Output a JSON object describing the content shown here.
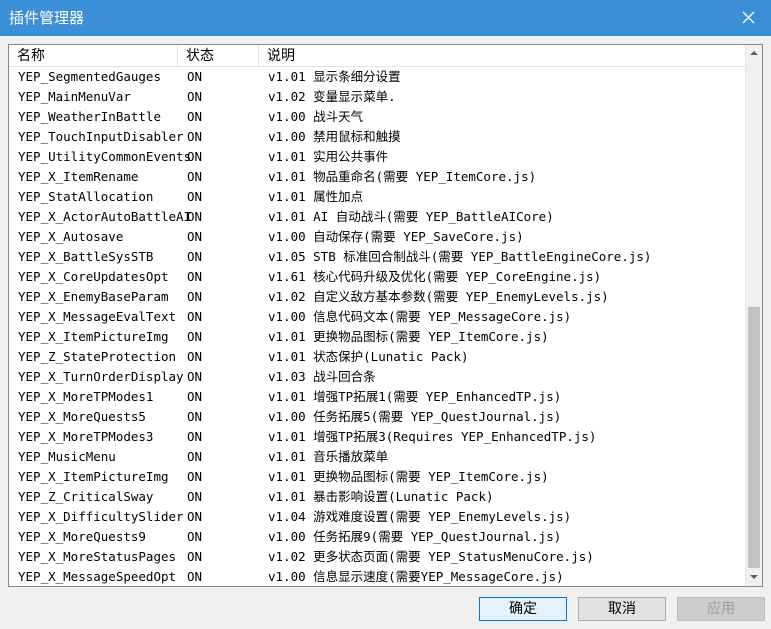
{
  "window": {
    "title": "插件管理器"
  },
  "columns": {
    "name": "名称",
    "status": "状态",
    "description": "说明"
  },
  "plugins": [
    {
      "name": "YEP_SegmentedGauges",
      "status": "ON",
      "description": "v1.01 显示条细分设置"
    },
    {
      "name": "YEP_MainMenuVar",
      "status": "ON",
      "description": "v1.02 变量显示菜单."
    },
    {
      "name": "YEP_WeatherInBattle",
      "status": "ON",
      "description": "v1.00 战斗天气"
    },
    {
      "name": "YEP_TouchInputDisabler",
      "status": "ON",
      "description": "v1.00 禁用鼠标和触摸"
    },
    {
      "name": "YEP_UtilityCommonEvents",
      "status": "ON",
      "description": "v1.01 实用公共事件"
    },
    {
      "name": "YEP_X_ItemRename",
      "status": "ON",
      "description": "v1.01 物品重命名(需要 YEP_ItemCore.js)"
    },
    {
      "name": "YEP_StatAllocation",
      "status": "ON",
      "description": "v1.01 属性加点"
    },
    {
      "name": "YEP_X_ActorAutoBattleAI",
      "status": "ON",
      "description": "v1.01 AI 自动战斗(需要 YEP_BattleAICore)"
    },
    {
      "name": "YEP_X_Autosave",
      "status": "ON",
      "description": "v1.00 自动保存(需要 YEP_SaveCore.js)"
    },
    {
      "name": "YEP_X_BattleSysSTB",
      "status": "ON",
      "description": "v1.05 STB 标准回合制战斗(需要 YEP_BattleEngineCore.js)"
    },
    {
      "name": "YEP_X_CoreUpdatesOpt",
      "status": "ON",
      "description": "v1.61 核心代码升级及优化(需要 YEP_CoreEngine.js)"
    },
    {
      "name": "YEP_X_EnemyBaseParam",
      "status": "ON",
      "description": "v1.02 自定义敌方基本参数(需要 YEP_EnemyLevels.js)"
    },
    {
      "name": "YEP_X_MessageEvalText",
      "status": "ON",
      "description": "v1.00 信息代码文本(需要 YEP_MessageCore.js)"
    },
    {
      "name": "YEP_X_ItemPictureImg",
      "status": "ON",
      "description": "v1.01 更换物品图标(需要 YEP_ItemCore.js)"
    },
    {
      "name": "YEP_Z_StateProtection",
      "status": "ON",
      "description": "v1.01 状态保护(Lunatic Pack)"
    },
    {
      "name": "YEP_X_TurnOrderDisplay",
      "status": "ON",
      "description": "v1.03 战斗回合条"
    },
    {
      "name": "YEP_X_MoreTPModes1",
      "status": "ON",
      "description": "v1.01 增强TP拓展1(需要 YEP_EnhancedTP.js)"
    },
    {
      "name": "YEP_X_MoreQuests5",
      "status": "ON",
      "description": "v1.00 任务拓展5(需要 YEP_QuestJournal.js)"
    },
    {
      "name": "YEP_X_MoreTPModes3",
      "status": "ON",
      "description": "v1.01 增强TP拓展3(Requires YEP_EnhancedTP.js)"
    },
    {
      "name": "YEP_MusicMenu",
      "status": "ON",
      "description": "v1.01 音乐播放菜单"
    },
    {
      "name": "YEP_X_ItemPictureImg",
      "status": "ON",
      "description": "v1.01 更换物品图标(需要 YEP_ItemCore.js)"
    },
    {
      "name": "YEP_Z_CriticalSway",
      "status": "ON",
      "description": "v1.01 暴击影响设置(Lunatic Pack)"
    },
    {
      "name": "YEP_X_DifficultySlider",
      "status": "ON",
      "description": "v1.04 游戏难度设置(需要 YEP_EnemyLevels.js)"
    },
    {
      "name": "YEP_X_MoreQuests9",
      "status": "ON",
      "description": "v1.00 任务拓展9(需要 YEP_QuestJournal.js)"
    },
    {
      "name": "YEP_X_MoreStatusPages",
      "status": "ON",
      "description": "v1.02 更多状态页面(需要 YEP_StatusMenuCore.js)"
    },
    {
      "name": "YEP_X_MessageSpeedOpt",
      "status": "ON",
      "description": "v1.00  信息显示速度(需要YEP_MessageCore.js)"
    }
  ],
  "buttons": {
    "ok": "确定",
    "cancel": "取消",
    "apply": "应用"
  },
  "colors": {
    "titlebar": "#3b8fd6",
    "accent": "#0078d7"
  }
}
